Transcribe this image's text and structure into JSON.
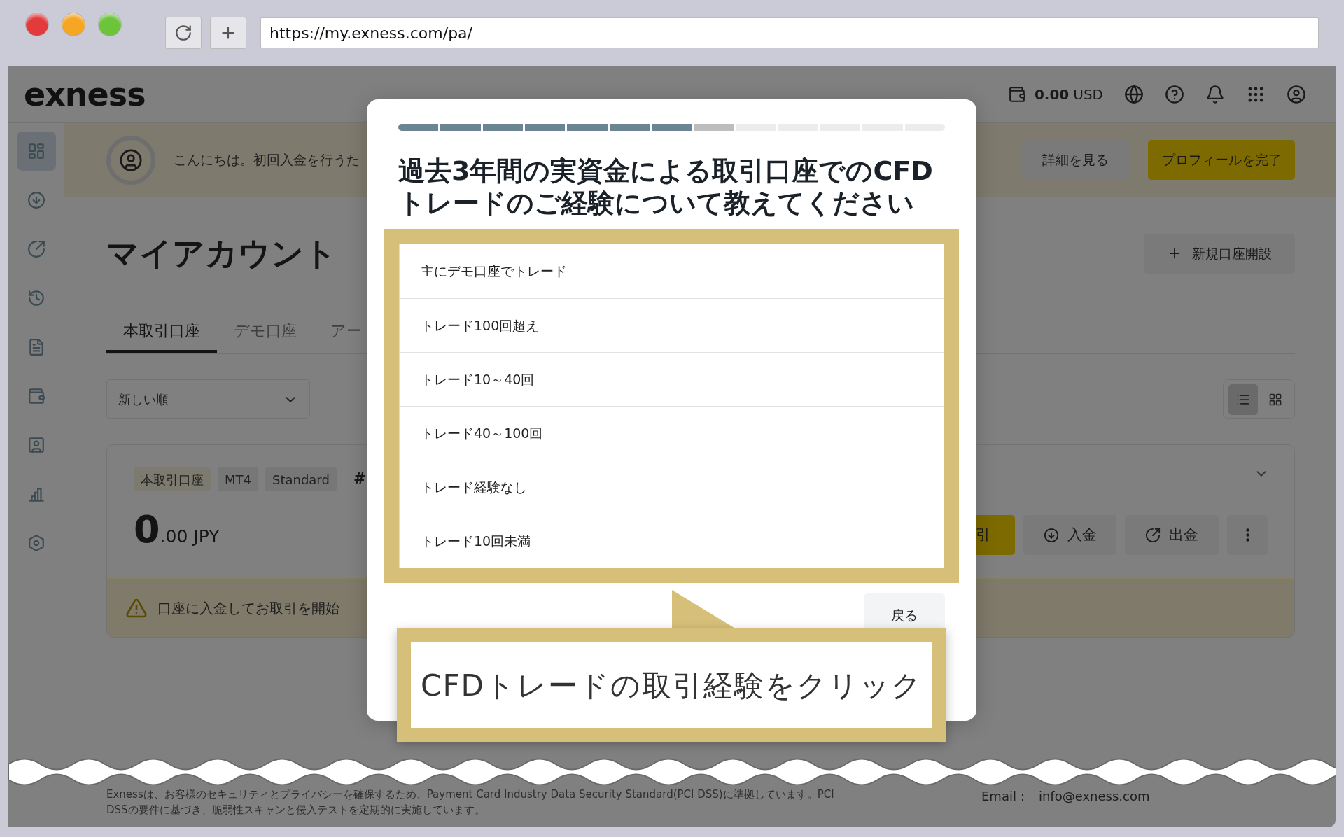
{
  "browser": {
    "url": "https://my.exness.com/pa/"
  },
  "header": {
    "logo": "exness",
    "balance_amount": "0.00",
    "balance_currency": "USD"
  },
  "sidebar": {
    "items": [
      {
        "selected": true
      },
      {
        "selected": false
      },
      {
        "selected": false
      },
      {
        "selected": false
      },
      {
        "selected": false
      },
      {
        "selected": false
      },
      {
        "selected": false
      },
      {
        "selected": false
      },
      {
        "selected": false
      }
    ]
  },
  "banner": {
    "text": "こんにちは。初回入金を行うた",
    "buttons": [
      {
        "label": "詳細を見る",
        "kind": "secondary"
      },
      {
        "label": "プロフィールを完了",
        "kind": "primary"
      }
    ]
  },
  "page": {
    "title": "マイアカウント",
    "new_account_button": "新規口座開設",
    "tabs": [
      {
        "label": "本取引口座",
        "selected": true
      },
      {
        "label": "デモ口座",
        "selected": false
      },
      {
        "label": "アー",
        "selected": false
      }
    ],
    "sort": {
      "value": "新しい順"
    },
    "view_toggle": [
      {
        "kind": "list",
        "selected": true
      },
      {
        "kind": "grid",
        "selected": false
      }
    ]
  },
  "account_card": {
    "tags": [
      "本取引口座",
      "MT4",
      "Standard"
    ],
    "number": "#",
    "balance_int": "0",
    "balance_rest": ".00 JPY",
    "actions": [
      {
        "kind": "trade",
        "label": "引"
      },
      {
        "kind": "deposit",
        "label": "入金"
      },
      {
        "kind": "withdraw",
        "label": "出金"
      },
      {
        "kind": "more"
      }
    ],
    "notice": "口座に入金してお取引を開始"
  },
  "footer": {
    "notice": "Exnessは、お客様のセキュリティとプライバシーを確保するため、Payment Card Industry Data Security Standard(PCI DSS)に準拠しています。PCI DSSの要件に基づき、脆弱性スキャンと侵入テストを定期的に実施しています。",
    "email_label": "Email：",
    "email": "info@exness.com"
  },
  "modal": {
    "progress": [
      {
        "done": true,
        "current": false
      },
      {
        "done": true,
        "current": false
      },
      {
        "done": true,
        "current": false
      },
      {
        "done": true,
        "current": false
      },
      {
        "done": true,
        "current": false
      },
      {
        "done": true,
        "current": false
      },
      {
        "done": true,
        "current": false
      },
      {
        "done": false,
        "current": true
      },
      {
        "done": false,
        "current": false
      },
      {
        "done": false,
        "current": false
      },
      {
        "done": false,
        "current": false
      },
      {
        "done": false,
        "current": false
      },
      {
        "done": false,
        "current": false
      }
    ],
    "title": "過去3年間の実資金による取引口座でのCFDトレードのご経験について教えてください",
    "options": [
      "主にデモ口座でトレード",
      "トレード100回超え",
      "トレード10～40回",
      "トレード40～100回",
      "トレード経験なし",
      "トレード10回未満"
    ],
    "back_button": "戻る"
  },
  "callout": {
    "text": "CFDトレードの取引経験をクリック"
  }
}
